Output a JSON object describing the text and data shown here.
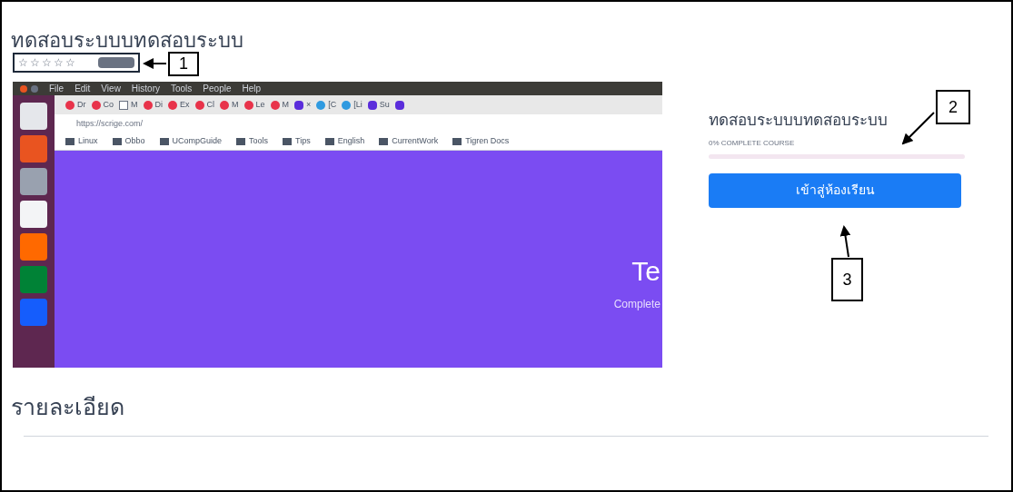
{
  "page_title": "ทดสอบระบบบทดสอบระบบ",
  "rating": {
    "stars": 0
  },
  "screenshot": {
    "menu": [
      "File",
      "Edit",
      "View",
      "History",
      "Tools",
      "People",
      "Help"
    ],
    "tabs": [
      {
        "label": "Dr",
        "kind": "red"
      },
      {
        "label": "Co",
        "kind": "red"
      },
      {
        "label": "M",
        "kind": "doc"
      },
      {
        "label": "Di",
        "kind": "red"
      },
      {
        "label": "Ex",
        "kind": "red"
      },
      {
        "label": "Cl",
        "kind": "red"
      },
      {
        "label": "M",
        "kind": "red"
      },
      {
        "label": "Le",
        "kind": "red"
      },
      {
        "label": "M",
        "kind": "red"
      },
      {
        "label": "×",
        "kind": "purple"
      },
      {
        "label": "[C",
        "kind": "blue"
      },
      {
        "label": "[Li",
        "kind": "blue"
      },
      {
        "label": "Su",
        "kind": "purple"
      },
      {
        "kind": "purple"
      }
    ],
    "address": "https://scrige.com/",
    "bookmarks": [
      "Linux",
      "Obbo",
      "UCompGuide",
      "Tools",
      "Tips",
      "English",
      "CurrentWork",
      "Tigren Docs"
    ],
    "hero_text": "Te",
    "hero_subtext": "Complete"
  },
  "course_card": {
    "title": "ทดสอบระบบบทดสอบระบบ",
    "progress_text": "0% COMPLETE COURSE",
    "level": 0,
    "button": "เข้าสู่ห้องเรียน"
  },
  "details": {
    "heading": "รายละเอียด"
  },
  "annotations": [
    "1",
    "2",
    "3"
  ]
}
